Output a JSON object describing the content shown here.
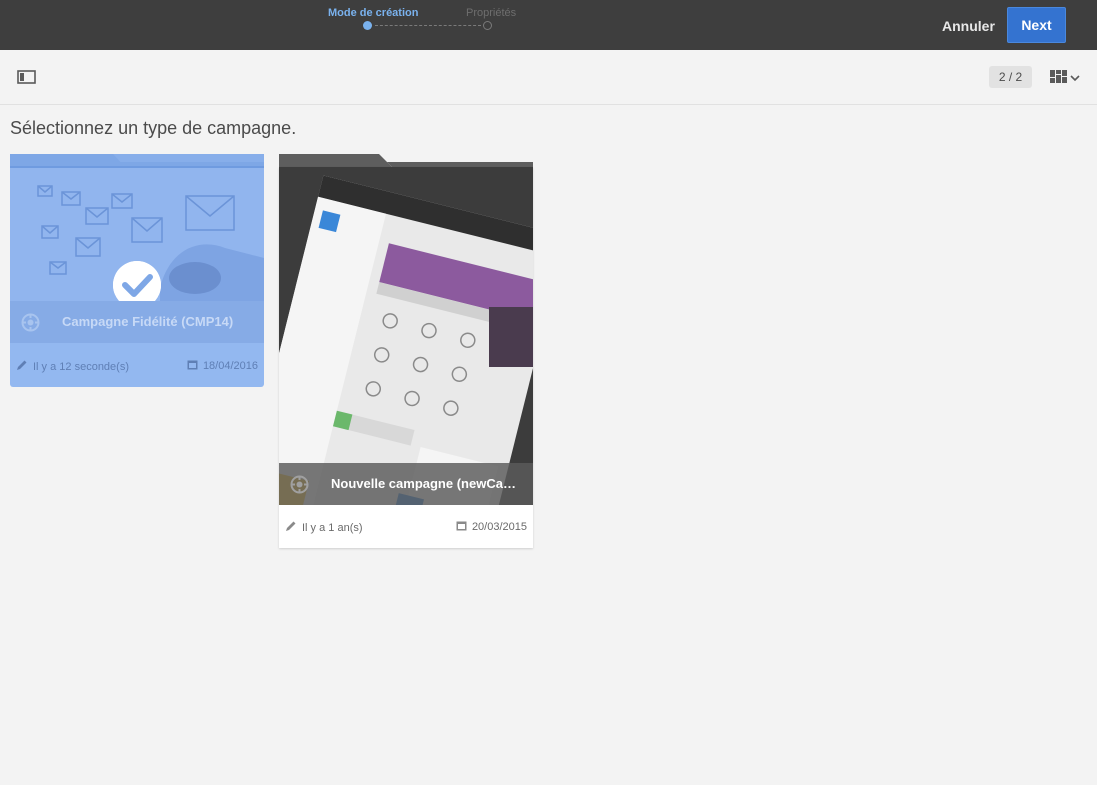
{
  "header": {
    "steps": [
      {
        "label": "Mode de création",
        "state": "active"
      },
      {
        "label": "Propriétés",
        "state": "inactive"
      }
    ],
    "cancel_label": "Annuler",
    "next_label": "Next"
  },
  "toolbar": {
    "page_counter": "2 / 2"
  },
  "main": {
    "heading": "Sélectionnez un type de campagne."
  },
  "cards": [
    {
      "name": "Campagne Fidélité (CMP14)",
      "modified": "Il y a 12 seconde(s)",
      "date": "18/04/2016",
      "selected": true
    },
    {
      "name": "Nouvelle campagne (newCamp…",
      "modified": "Il y a 1 an(s)",
      "date": "20/03/2015",
      "selected": false
    }
  ],
  "colors": {
    "topbar": "#3e3e3e",
    "accent": "#3473d0",
    "step_active": "#7ab2ee",
    "selected_card": "#93b8f0",
    "background": "#f3f3f3"
  },
  "icons": {
    "panel_toggle": "panel-toggle-icon",
    "view_switch": "grid-view-icon",
    "card_badge": "template-icon",
    "modified": "pencil-icon",
    "date": "calendar-icon",
    "selected": "checkmark-icon"
  }
}
